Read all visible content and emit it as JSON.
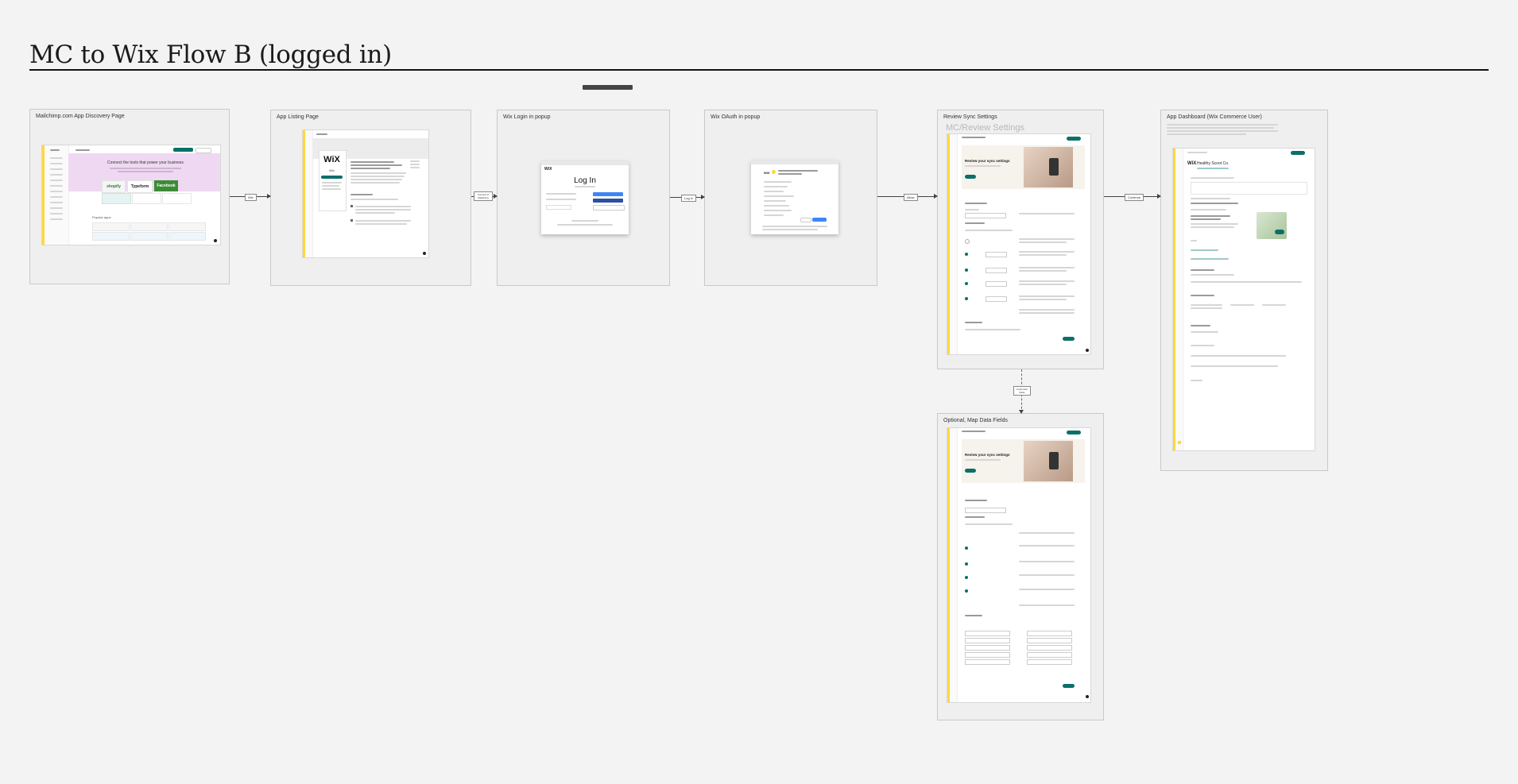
{
  "title": "MC to Wix Flow B (logged in)",
  "frames": [
    {
      "id": "discovery",
      "label": "Mailchimp.com App Discovery Page"
    },
    {
      "id": "listing",
      "label": "App Listing Page"
    },
    {
      "id": "login",
      "label": "Wix Login  in popup"
    },
    {
      "id": "oauth",
      "label": "Wix OAuth in popup"
    },
    {
      "id": "review",
      "label": "Review Sync Settings"
    },
    {
      "id": "dashboard",
      "label": "App Dashboard (Wix Commerce User)"
    },
    {
      "id": "mapfields",
      "label": "Optional, Map Data Fields"
    }
  ],
  "connectors": [
    {
      "label": "Wix"
    },
    {
      "label": "Connect to Mailchimp"
    },
    {
      "label": "Log in"
    },
    {
      "label": "Allow"
    },
    {
      "label": "Continue"
    },
    {
      "label": "Customize fields"
    }
  ],
  "screens": {
    "discovery": {
      "banner": "Connect the tools that power your business",
      "logos": [
        "shopify",
        "Typeform",
        "Facebook"
      ],
      "section": "Popular apps"
    },
    "listing": {
      "logo": "WiX",
      "heading": "Wix"
    },
    "login": {
      "logo": "WiX",
      "heading": "Log In"
    },
    "oauth": {
      "logo": "WiX"
    },
    "review": {
      "overlay": "MC/Review Settings",
      "hero": "Review your sync settings"
    },
    "dashboard": {
      "store": "Healthy Scoot Co.",
      "logo": "WiX"
    },
    "mapfields": {
      "hero": "Review your sync settings"
    }
  },
  "colors": {
    "accent": "#0b6f6a",
    "banner": "#efd8f2",
    "yellow": "#ffd83b"
  }
}
